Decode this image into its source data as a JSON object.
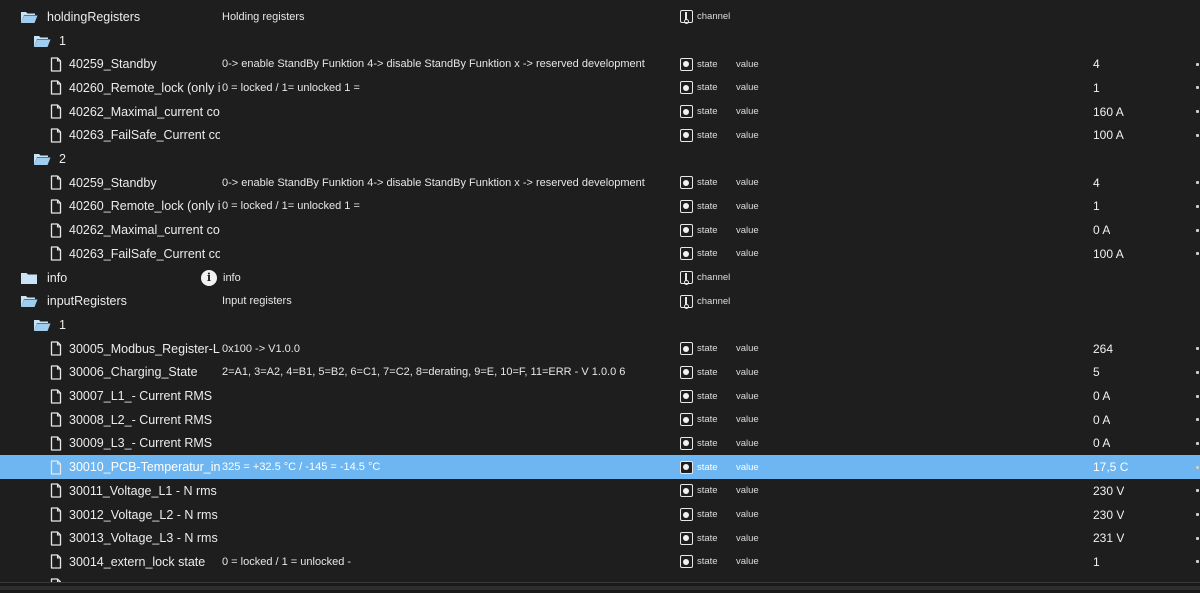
{
  "colors": {
    "background": "#1e1e1e",
    "selected_row": "#6db6f2",
    "folder": "#c9e4f7",
    "text": "#e8e8e8"
  },
  "rows": [
    {
      "kind": "folder-open",
      "level": 0,
      "name": "holdingRegisters",
      "desc": "Holding registers",
      "type": "channel",
      "role": "",
      "value": ""
    },
    {
      "kind": "folder-open",
      "level": 1,
      "name": "1",
      "desc": "",
      "type": "",
      "role": "",
      "value": ""
    },
    {
      "kind": "file",
      "level": 2,
      "name": "40259_Standby",
      "desc": "0-> enable StandBy Funktion 4-> disable StandBy Funktion x -> reserved development",
      "type": "state",
      "role": "value",
      "value": "4"
    },
    {
      "kind": "file",
      "level": 2,
      "name": "40260_Remote_lock (only i...",
      "desc": "0 = locked / 1= unlocked 1 =",
      "type": "state",
      "role": "value",
      "value": "1"
    },
    {
      "kind": "file",
      "level": 2,
      "name": "40262_Maximal_current co...",
      "desc": "",
      "type": "state",
      "role": "value",
      "value": "160 A"
    },
    {
      "kind": "file",
      "level": 2,
      "name": "40263_FailSafe_Current co...",
      "desc": "",
      "type": "state",
      "role": "value",
      "value": "100 A"
    },
    {
      "kind": "folder-open",
      "level": 1,
      "name": "2",
      "desc": "",
      "type": "",
      "role": "",
      "value": ""
    },
    {
      "kind": "file",
      "level": 2,
      "name": "40259_Standby",
      "desc": "0-> enable StandBy Funktion 4-> disable StandBy Funktion x -> reserved development",
      "type": "state",
      "role": "value",
      "value": "4"
    },
    {
      "kind": "file",
      "level": 2,
      "name": "40260_Remote_lock (only i...",
      "desc": "0 = locked / 1= unlocked 1 =",
      "type": "state",
      "role": "value",
      "value": "1"
    },
    {
      "kind": "file",
      "level": 2,
      "name": "40262_Maximal_current co...",
      "desc": "",
      "type": "state",
      "role": "value",
      "value": "0 A"
    },
    {
      "kind": "file",
      "level": 2,
      "name": "40263_FailSafe_Current co...",
      "desc": "",
      "type": "state",
      "role": "value",
      "value": "100 A"
    },
    {
      "kind": "folder",
      "level": 0,
      "name": "info",
      "desc": "info",
      "descIcon": "info-icon",
      "type": "channel",
      "role": "",
      "value": ""
    },
    {
      "kind": "folder-open",
      "level": 0,
      "name": "inputRegisters",
      "desc": "Input registers",
      "type": "channel",
      "role": "",
      "value": ""
    },
    {
      "kind": "folder-open",
      "level": 1,
      "name": "1",
      "desc": "",
      "type": "",
      "role": "",
      "value": ""
    },
    {
      "kind": "file",
      "level": 2,
      "name": "30005_Modbus_Register-L...",
      "desc": "0x100 -> V1.0.0",
      "type": "state",
      "role": "value",
      "value": "264"
    },
    {
      "kind": "file",
      "level": 2,
      "name": "30006_Charging_State",
      "desc": "2=A1, 3=A2, 4=B1, 5=B2, 6=C1, 7=C2, 8=derating, 9=E, 10=F, 11=ERR - V 1.0.0 6",
      "type": "state",
      "role": "value",
      "value": "5"
    },
    {
      "kind": "file",
      "level": 2,
      "name": "30007_L1_- Current RMS",
      "desc": "",
      "type": "state",
      "role": "value",
      "value": "0 A"
    },
    {
      "kind": "file",
      "level": 2,
      "name": "30008_L2_- Current RMS",
      "desc": "",
      "type": "state",
      "role": "value",
      "value": "0 A"
    },
    {
      "kind": "file",
      "level": 2,
      "name": "30009_L3_- Current RMS",
      "desc": "",
      "type": "state",
      "role": "value",
      "value": "0 A"
    },
    {
      "kind": "file",
      "level": 2,
      "name": "30010_PCB-Temperatur_in ...",
      "desc": "325 = +32.5 °C / -145 = -14.5 °C",
      "type": "state",
      "role": "value",
      "value": "17,5 C",
      "selected": true
    },
    {
      "kind": "file",
      "level": 2,
      "name": "30011_Voltage_L1 - N rms ...",
      "desc": "",
      "type": "state",
      "role": "value",
      "value": "230 V"
    },
    {
      "kind": "file",
      "level": 2,
      "name": "30012_Voltage_L2 - N rms ...",
      "desc": "",
      "type": "state",
      "role": "value",
      "value": "230 V"
    },
    {
      "kind": "file",
      "level": 2,
      "name": "30013_Voltage_L3 - N rms ...",
      "desc": "",
      "type": "state",
      "role": "value",
      "value": "231 V"
    },
    {
      "kind": "file",
      "level": 2,
      "name": "30014_extern_lock state",
      "desc": "0 = locked / 1 = unlocked -",
      "type": "state",
      "role": "value",
      "value": "1"
    },
    {
      "kind": "file",
      "level": 2,
      "name": "",
      "desc": "",
      "type": "",
      "role": "",
      "value": ""
    }
  ]
}
